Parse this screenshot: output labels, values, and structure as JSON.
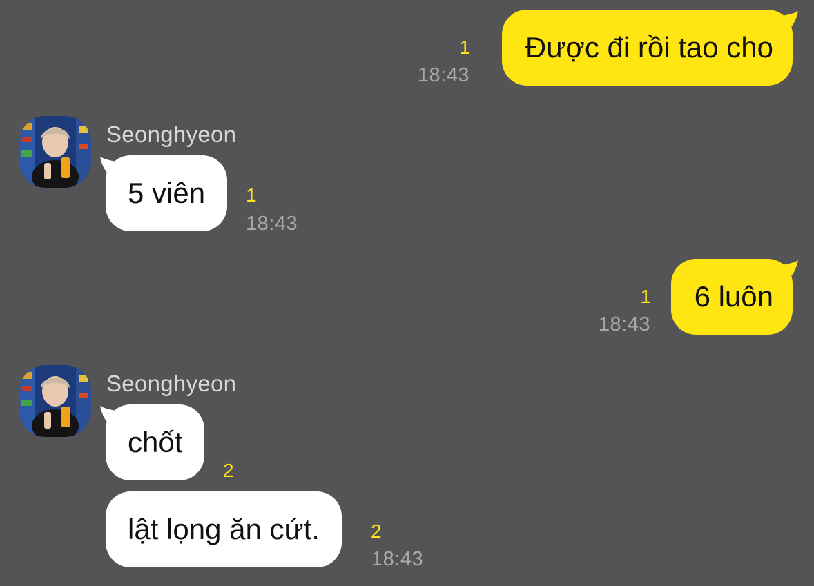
{
  "colors": {
    "background": "#545355",
    "outgoing_bubble": "#FFE512",
    "incoming_bubble": "#FFFFFF",
    "read_count": "#FFE512",
    "timestamp": "#A9A8AA",
    "sender_name": "#D9D8DA"
  },
  "messages": [
    {
      "direction": "out",
      "text": "Được đi rồi tao cho",
      "read_count": "1",
      "time": "18:43"
    },
    {
      "direction": "in",
      "sender": "Seonghyeon",
      "text": "5 viên",
      "read_count": "1",
      "time": "18:43"
    },
    {
      "direction": "out",
      "text": "6 luôn",
      "read_count": "1",
      "time": "18:43"
    },
    {
      "direction": "in",
      "sender": "Seonghyeon",
      "text": "chốt",
      "read_count": "2",
      "time": ""
    },
    {
      "direction": "in",
      "text": "lật lọng ăn cứt.",
      "read_count": "2",
      "time": "18:43"
    }
  ]
}
